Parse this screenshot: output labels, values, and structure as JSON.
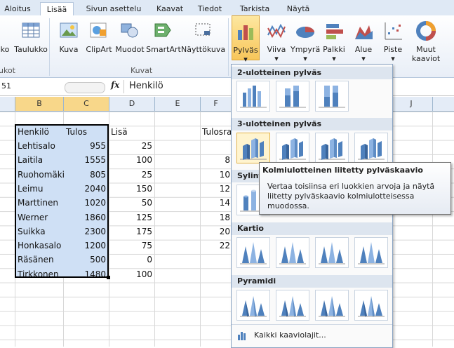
{
  "tabs": [
    "Aloitus",
    "Lisää",
    "Sivun asettelu",
    "Kaavat",
    "Tiedot",
    "Tarkista",
    "Näytä"
  ],
  "ribbon": {
    "buttons": {
      "pivot": "ko",
      "table": "Taulukko",
      "picture": "Kuva",
      "clipart": "ClipArt",
      "shapes": "Muodot",
      "smartart": "SmartArt",
      "screenshot": "Näyttökuva",
      "column": "Pylväs",
      "line": "Viiva",
      "pie": "Ympyrä",
      "bar": "Palkki",
      "area": "Alue",
      "scatter": "Piste",
      "other_line1": "Muut",
      "other_line2": "kaaviot"
    },
    "groups": {
      "tables": "ukot",
      "illustrations": "Kuvat"
    }
  },
  "formula_bar": {
    "name_box": "51",
    "fx": "fx",
    "value": "Henkilö"
  },
  "columns": [
    "B",
    "C",
    "D",
    "E",
    "F",
    "J"
  ],
  "sheet": {
    "header": {
      "b": "Henkilö",
      "c": "Tulos",
      "d": "Lisä",
      "f": "Tulosra"
    },
    "rows": [
      {
        "name": "Lehtisalo",
        "tulos": "955",
        "lisa": "25",
        "f": ""
      },
      {
        "name": "Laitila",
        "tulos": "1555",
        "lisa": "100",
        "f": "8"
      },
      {
        "name": "Ruohomäki",
        "tulos": "805",
        "lisa": "25",
        "f": "10"
      },
      {
        "name": "Leimu",
        "tulos": "2040",
        "lisa": "150",
        "f": "12"
      },
      {
        "name": "Marttinen",
        "tulos": "1020",
        "lisa": "50",
        "f": "14"
      },
      {
        "name": "Werner",
        "tulos": "1860",
        "lisa": "125",
        "f": "18"
      },
      {
        "name": "Suikka",
        "tulos": "2300",
        "lisa": "175",
        "f": "20"
      },
      {
        "name": "Honkasalo",
        "tulos": "1200",
        "lisa": "75",
        "f": "22"
      },
      {
        "name": "Räsänen",
        "tulos": "500",
        "lisa": "0",
        "f": ""
      },
      {
        "name": "Tirkkonen",
        "tulos": "1480",
        "lisa": "100",
        "f": ""
      }
    ]
  },
  "dropdown": {
    "sections": [
      "2-ulotteinen pylväs",
      "3-ulotteinen pylväs",
      "Sylinteri",
      "Kartio",
      "Pyramidi"
    ],
    "sylinteri_visible": "Sylint",
    "all_charts": "Kaikki kaaviolajit..."
  },
  "tooltip": {
    "title": "Kolmiulotteinen liitetty pylväskaavio",
    "body": "Vertaa toisiinsa eri luokkien arvoja ja näytä liitetty pylväskaavio kolmiulotteisessa muodossa."
  },
  "colors": {
    "selection": "#cfe0f5",
    "pressed": "#f8c65a",
    "chart_blue": "#4f81bd"
  }
}
